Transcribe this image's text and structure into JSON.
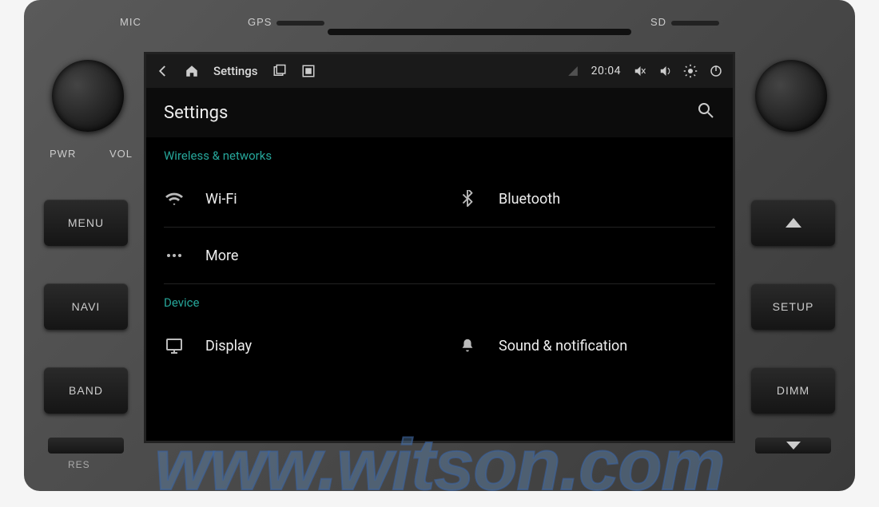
{
  "hardware": {
    "mic": "MIC",
    "gps": "GPS",
    "sd": "SD",
    "pwr": "PWR",
    "vol": "VOL",
    "menu": "MENU",
    "navi": "NAVI",
    "band": "BAND",
    "setup": "SETUP",
    "dimm": "DIMM",
    "res": "RES"
  },
  "statusbar": {
    "title": "Settings",
    "time": "20:04"
  },
  "header": {
    "title": "Settings"
  },
  "sections": {
    "wireless": {
      "label": "Wireless & networks",
      "items": {
        "wifi": "Wi-Fi",
        "bluetooth": "Bluetooth",
        "more": "More"
      }
    },
    "device": {
      "label": "Device",
      "items": {
        "display": "Display",
        "sound": "Sound & notification"
      }
    }
  },
  "watermark": "www.witson.com"
}
